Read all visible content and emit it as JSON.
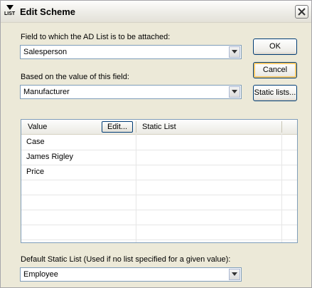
{
  "window": {
    "title": "Edit Scheme",
    "icon_label": "LIST"
  },
  "field1": {
    "label": "Field to which the AD List is to be attached:",
    "value": "Salesperson"
  },
  "field2": {
    "label": "Based on the value of this field:",
    "value": "Manufacturer"
  },
  "buttons": {
    "ok": "OK",
    "cancel": "Cancel",
    "static_lists": "Static lists..."
  },
  "table": {
    "headers": {
      "value": "Value",
      "edit": "Edit...",
      "static_list": "Static List"
    },
    "rows": [
      {
        "value": "Case",
        "static_list": ""
      },
      {
        "value": "James Rigley",
        "static_list": ""
      },
      {
        "value": "Price",
        "static_list": ""
      }
    ]
  },
  "default_list": {
    "label": "Default Static List (Used if no list specified for a given value):",
    "value": "Employee"
  }
}
